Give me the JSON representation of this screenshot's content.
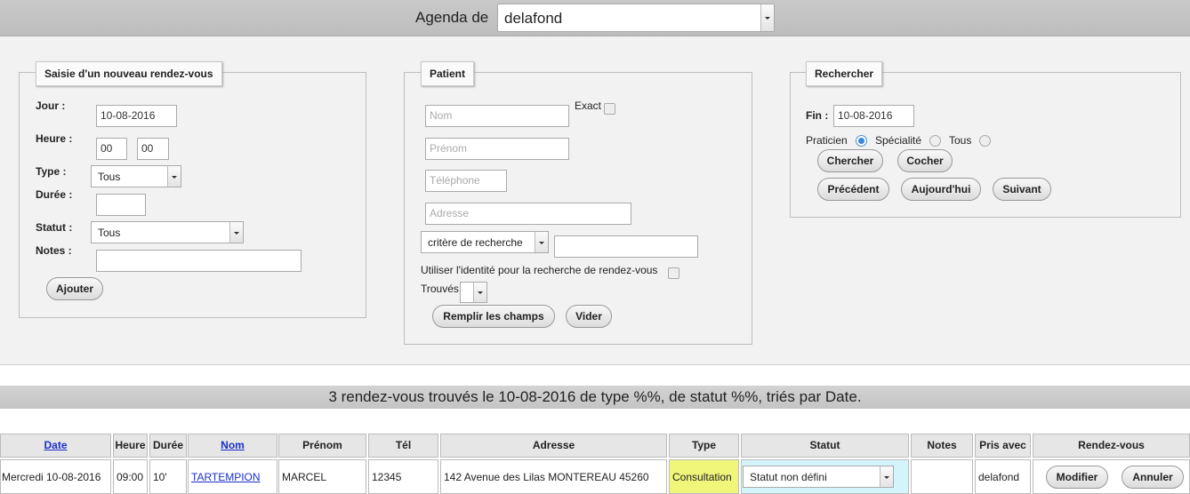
{
  "header": {
    "agenda_label": "Agenda de",
    "agenda_value": "delafond"
  },
  "saisie": {
    "legend": "Saisie d'un nouveau rendez-vous",
    "jour_label": "Jour :",
    "jour_value": "10-08-2016",
    "heure_label": "Heure :",
    "heure_h": "00",
    "heure_m": "00",
    "type_label": "Type :",
    "type_value": "Tous",
    "duree_label": "Durée :",
    "duree_value": "",
    "statut_label": "Statut :",
    "statut_value": "Tous",
    "notes_label": "Notes :",
    "notes_value": "",
    "add_button": "Ajouter"
  },
  "patient": {
    "legend": "Patient",
    "nom_placeholder": "Nom",
    "exact_label": "Exact",
    "prenom_placeholder": "Prénom",
    "telephone_placeholder": "Téléphone",
    "adresse_placeholder": "Adresse",
    "critere_value": "critère de recherche",
    "critere_input": "",
    "identite_label": "Utiliser l'identité pour la recherche de rendez-vous",
    "trouves_label": "Trouvés",
    "fill_button": "Remplir les champs",
    "clear_button": "Vider"
  },
  "recherche": {
    "legend": "Rechercher",
    "fin_label": "Fin :",
    "fin_value": "10-08-2016",
    "praticien_label": "Praticien",
    "specialite_label": "Spécialité",
    "tous_label": "Tous",
    "selected_radio": "praticien",
    "search_button": "Chercher",
    "check_button": "Cocher",
    "prev_button": "Précédent",
    "today_button": "Aujourd'hui",
    "next_button": "Suivant"
  },
  "results": {
    "summary": "3 rendez-vous trouvés le 10-08-2016 de type %%, de statut %%, triés par Date.",
    "columns": [
      "Date",
      "Heure",
      "Durée",
      "Nom",
      "Prénom",
      "Tél",
      "Adresse",
      "Type",
      "Statut",
      "Notes",
      "Pris avec",
      "Rendez-vous"
    ],
    "rows": [
      {
        "date": "Mercredi 10-08-2016",
        "heure": "09:00",
        "duree": "10'",
        "nom": "TARTEMPION",
        "prenom": "MARCEL",
        "tel": "12345",
        "adresse": "142 Avenue des Lilas MONTEREAU 45260",
        "type": "Consultation",
        "statut": "Statut non défini",
        "notes": "",
        "pris_avec": "delafond",
        "modify_button": "Modifier",
        "cancel_button": "Annuler"
      }
    ]
  },
  "colors": {
    "type_highlight": "#f0f67a",
    "statut_highlight": "#d4f4fb",
    "link": "#1a2fcc"
  }
}
